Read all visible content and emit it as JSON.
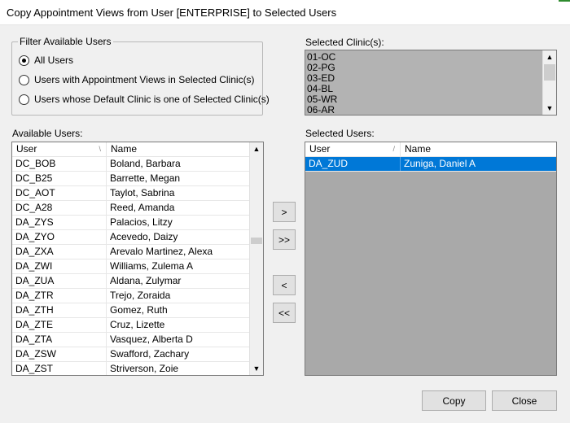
{
  "window": {
    "title": "Copy Appointment Views from User [ENTERPRISE] to Selected Users"
  },
  "filter": {
    "legend": "Filter Available Users",
    "options": [
      {
        "label": "All Users",
        "checked": true
      },
      {
        "label": "Users with Appointment Views in Selected Clinic(s)",
        "checked": false
      },
      {
        "label": "Users whose Default Clinic is one of Selected Clinic(s)",
        "checked": false
      }
    ]
  },
  "selected_clinics": {
    "label": "Selected Clinic(s):",
    "items": [
      "01-OC",
      "02-PG",
      "03-ED",
      "04-BL",
      "05-WR",
      "06-AR"
    ]
  },
  "available_users": {
    "label": "Available Users:",
    "columns": [
      "User",
      "Name"
    ],
    "rows": [
      [
        "DC_BOB",
        "Boland, Barbara"
      ],
      [
        "DC_B25",
        "Barrette, Megan"
      ],
      [
        "DC_AOT",
        "Taylot, Sabrina"
      ],
      [
        "DC_A28",
        "Reed, Amanda"
      ],
      [
        "DA_ZYS",
        "Palacios, Litzy"
      ],
      [
        "DA_ZYO",
        "Acevedo, Daizy"
      ],
      [
        "DA_ZXA",
        "Arevalo Martinez, Alexa"
      ],
      [
        "DA_ZWI",
        "Williams, Zulema A"
      ],
      [
        "DA_ZUA",
        "Aldana, Zulymar"
      ],
      [
        "DA_ZTR",
        "Trejo, Zoraida"
      ],
      [
        "DA_ZTH",
        "Gomez, Ruth"
      ],
      [
        "DA_ZTE",
        "Cruz, Lizette"
      ],
      [
        "DA_ZTA",
        "Vasquez, Alberta D"
      ],
      [
        "DA_ZSW",
        "Swafford, Zachary"
      ],
      [
        "DA_ZST",
        "Striverson, Zoie"
      ]
    ]
  },
  "selected_users": {
    "label": "Selected Users:",
    "columns": [
      "User",
      "Name"
    ],
    "rows": [
      [
        "DA_ZUD",
        "Zuniga, Daniel A"
      ]
    ]
  },
  "transfer_buttons": {
    "add": ">",
    "add_all": ">>",
    "remove": "<",
    "remove_all": "<<"
  },
  "footer": {
    "copy": "Copy",
    "close": "Close"
  },
  "colors": {
    "selection": "#0078d7",
    "list_disabled_bg": "#a9a9a9",
    "clinic_bg": "#b3b3b3"
  }
}
